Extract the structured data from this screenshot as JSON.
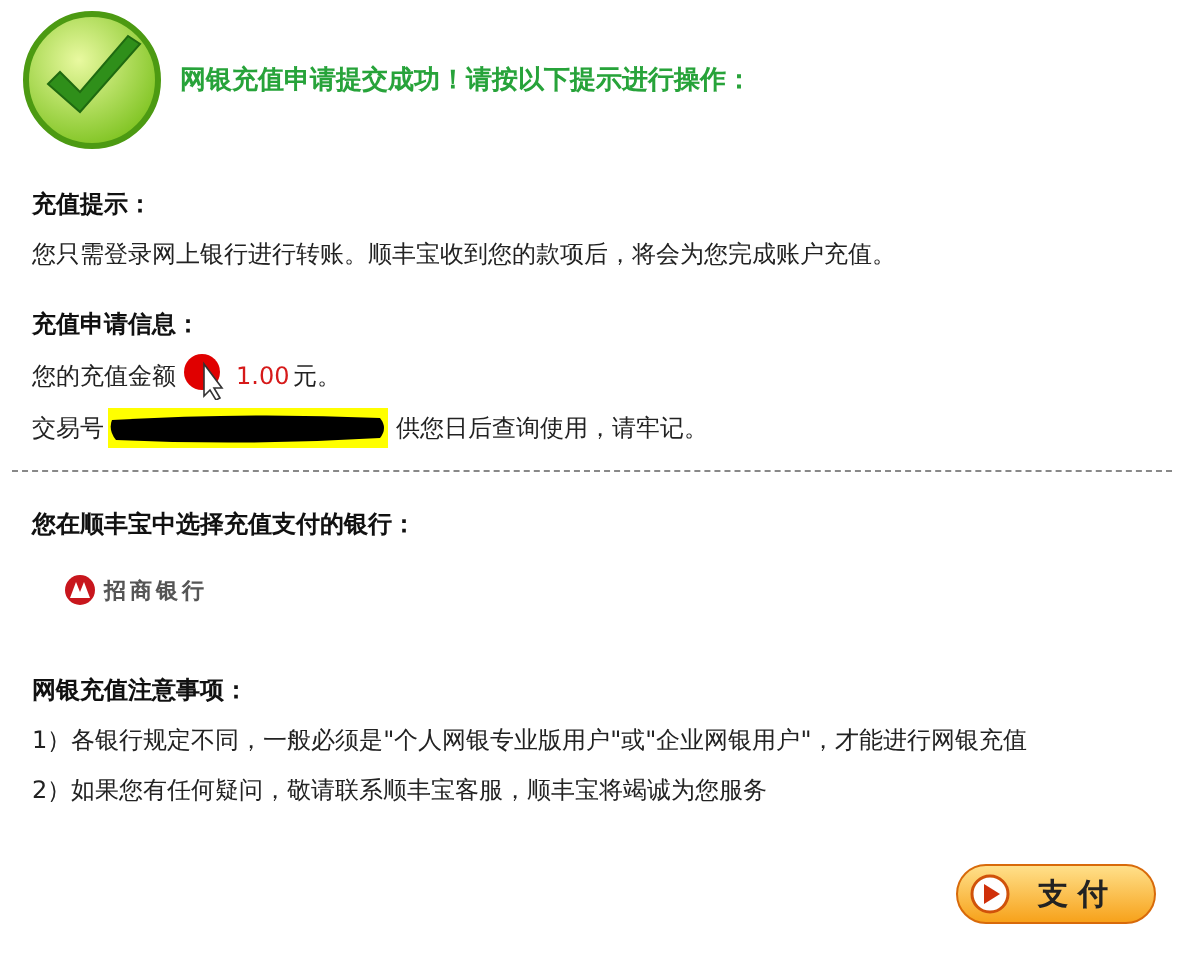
{
  "header": {
    "title": "网银充值申请提交成功！请按以下提示进行操作："
  },
  "tip": {
    "heading": "充值提示：",
    "text": "您只需登录网上银行进行转账。顺丰宝收到您的款项后，将会为您完成账户充值。"
  },
  "info": {
    "heading": "充值申请信息：",
    "amount_label": "您的充值金额",
    "amount": "1.00",
    "amount_unit": "元。",
    "txn_label": "交易号",
    "txn_note": "供您日后查询使用，请牢记。"
  },
  "bank": {
    "heading": "您在顺丰宝中选择充值支付的银行：",
    "name": "招商银行"
  },
  "notes": {
    "heading": "网银充值注意事项：",
    "items": [
      "1）各银行规定不同，一般必须是\"个人网银专业版用户\"或\"企业网银用户\"，才能进行网银充值",
      "2）如果您有任何疑问，敬请联系顺丰宝客服，顺丰宝将竭诚为您服务"
    ]
  },
  "pay_button": {
    "label": "支 付"
  }
}
